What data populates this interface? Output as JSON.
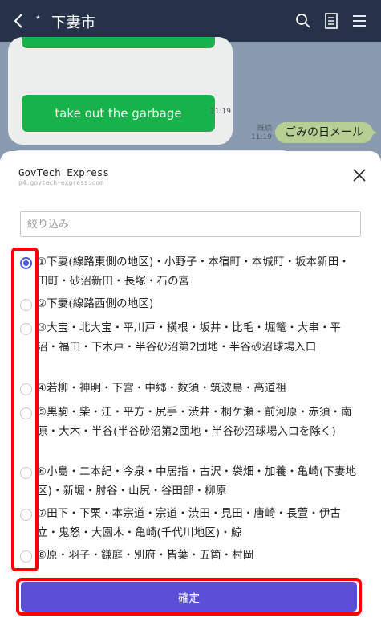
{
  "header": {
    "star": "⋆",
    "title": "下妻市"
  },
  "chat": {
    "garbage_button": "take out the garbage",
    "time_1": "11:19",
    "read_label": "既読",
    "time_2": "11:19",
    "user_message": "ごみの日メール"
  },
  "sheet": {
    "title": "GovTech Express",
    "url": "p4.govtech-express.com",
    "filter_placeholder": "絞り込み",
    "options": [
      {
        "label": "①下妻(線路東側の地区)・小野子・本宿町・本城町・坂本新田・田町・砂沼新田・長塚・石の宮",
        "selected": true
      },
      {
        "label": "②下妻(線路西側の地区)",
        "selected": false
      },
      {
        "label": "③大宝・北大宝・平川戸・横根・坂井・比毛・堀篭・大串・平沼・福田・下木戸・半谷砂沼第2団地・半谷砂沼球場入口",
        "selected": false
      },
      {
        "label": "④若柳・神明・下宮・中郷・数須・筑波島・高道祖",
        "selected": false
      },
      {
        "label": "⑤黒駒・柴・江・平方・尻手・渋井・桐ケ瀬・前河原・赤須・南原・大木・半谷(半谷砂沼第2団地・半谷砂沼球場入口を除く)",
        "selected": false
      },
      {
        "label": "⑥小島・二本紀・今泉・中居指・古沢・袋畑・加養・亀崎(下妻地区)・新堀・肘谷・山尻・谷田部・柳原",
        "selected": false
      },
      {
        "label": "⑦田下・下栗・本宗道・宗道・渋田・見田・唐崎・長萱・伊古立・鬼怒・大園木・亀崎(千代川地区)・鯨",
        "selected": false
      },
      {
        "label": "⑧原・羽子・鎌庭・別府・皆葉・五箇・村岡",
        "selected": false
      }
    ],
    "confirm_label": "確定"
  },
  "colors": {
    "topbar": "#253249",
    "accent": "#5b4fd8",
    "highlight": "#ff0000",
    "green": "#17b24a"
  }
}
